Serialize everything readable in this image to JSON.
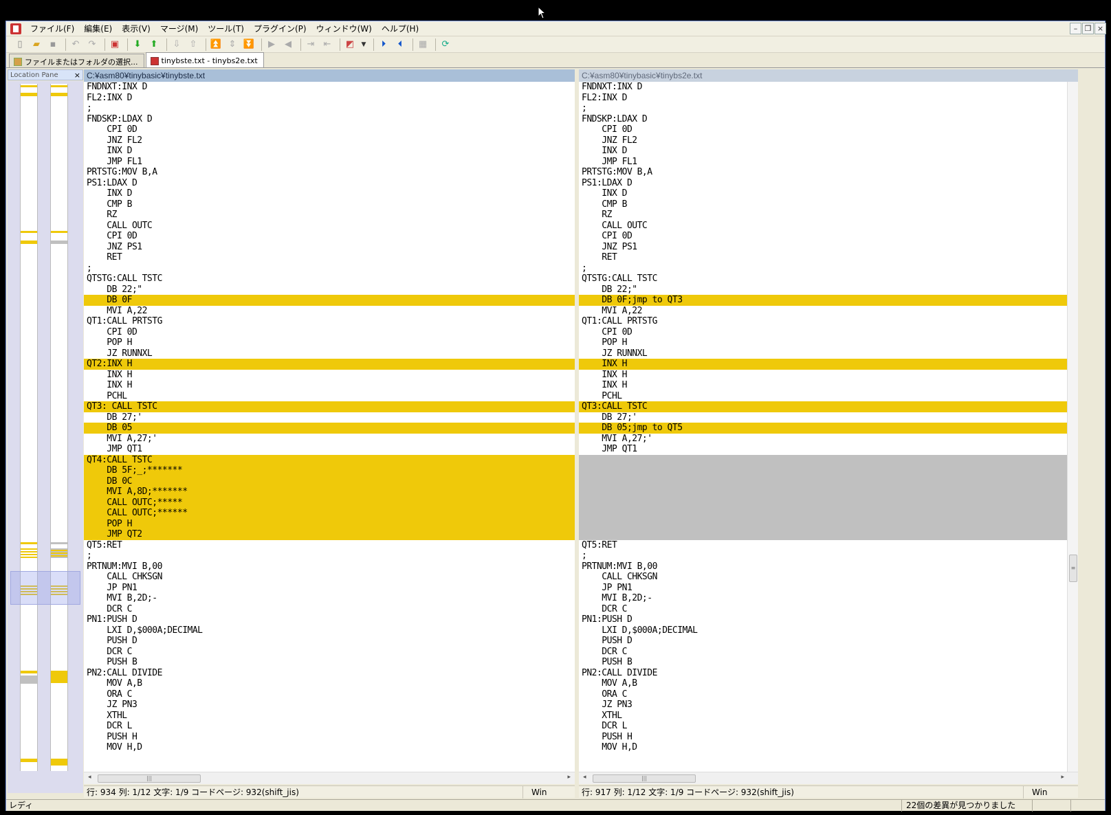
{
  "menu": [
    "ファイル(F)",
    "編集(E)",
    "表示(V)",
    "マージ(M)",
    "ツール(T)",
    "プラグイン(P)",
    "ウィンドウ(W)",
    "ヘルプ(H)"
  ],
  "tabs": [
    {
      "label": "ファイルまたはフォルダの選択..."
    },
    {
      "label": "tinybste.txt - tinybs2e.txt"
    }
  ],
  "location_pane": {
    "title": "Location Pane",
    "close": "×"
  },
  "left": {
    "path": "C:¥asm80¥tinybasic¥tinybste.txt",
    "status": "行: 934  列: 1/12  文字: 1/9  コードページ: 932(shift_jis)",
    "eol": "Win"
  },
  "right": {
    "path": "C:¥asm80¥tinybasic¥tinybs2e.txt",
    "status": "行: 917  列: 1/12  文字: 1/9  コードページ: 932(shift_jis)",
    "eol": "Win"
  },
  "status_bar": {
    "ready": "レディ",
    "diff_count": "22個の差異が見つかりました"
  },
  "colors": {
    "diff": "#efc90a",
    "gap": "#c0c0c0",
    "word_diff": "#f5c8a0"
  },
  "left_lines": [
    {
      "t": "FNDNXT:INX D"
    },
    {
      "t": "FL2:INX D"
    },
    {
      "t": ";"
    },
    {
      "t": "FNDSKP:LDAX D"
    },
    {
      "t": "    CPI 0D"
    },
    {
      "t": "    JNZ FL2"
    },
    {
      "t": "    INX D"
    },
    {
      "t": "    JMP FL1"
    },
    {
      "t": "PRTSTG:MOV B,A"
    },
    {
      "t": "PS1:LDAX D"
    },
    {
      "t": "    INX D"
    },
    {
      "t": "    CMP B"
    },
    {
      "t": "    RZ"
    },
    {
      "t": "    CALL OUTC"
    },
    {
      "t": "    CPI 0D"
    },
    {
      "t": "    JNZ PS1"
    },
    {
      "t": "    RET"
    },
    {
      "t": ";"
    },
    {
      "t": "QTSTG:CALL TSTC"
    },
    {
      "t": "    DB 22;\""
    },
    {
      "t": "    DB 0F",
      "k": "diff"
    },
    {
      "t": "    MVI A,22"
    },
    {
      "t": "QT1:CALL PRTSTG"
    },
    {
      "t": "    CPI 0D"
    },
    {
      "t": "    POP H"
    },
    {
      "t": "    JZ RUNNXL"
    },
    {
      "t": "QT2:INX H",
      "k": "diff"
    },
    {
      "t": "    INX H"
    },
    {
      "t": "    INX H"
    },
    {
      "t": "    PCHL"
    },
    {
      "t": "QT3: CALL TSTC",
      "k": "diff"
    },
    {
      "t": "    DB 27;'"
    },
    {
      "t": "    DB 05",
      "k": "diff"
    },
    {
      "t": "    MVI A,27;'"
    },
    {
      "t": "    JMP QT1"
    },
    {
      "t": "QT4:CALL TSTC",
      "k": "diff"
    },
    {
      "t": "    DB 5F;_;*******",
      "k": "diff"
    },
    {
      "t": "    DB 0C",
      "k": "diff"
    },
    {
      "t": "    MVI A,8D;*******",
      "k": "diff"
    },
    {
      "t": "    CALL OUTC;*****",
      "k": "diff"
    },
    {
      "t": "    CALL OUTC;******",
      "k": "diff"
    },
    {
      "t": "    POP H",
      "k": "diff"
    },
    {
      "t": "    JMP QT2",
      "k": "diff"
    },
    {
      "t": "QT5:RET"
    },
    {
      "t": ";"
    },
    {
      "t": "PRTNUM:MVI B,00"
    },
    {
      "t": "    CALL CHKSGN"
    },
    {
      "t": "    JP PN1"
    },
    {
      "t": "    MVI B,2D;-"
    },
    {
      "t": "    DCR C"
    },
    {
      "t": "PN1:PUSH D"
    },
    {
      "t": "    LXI D,$000A;DECIMAL"
    },
    {
      "t": "    PUSH D"
    },
    {
      "t": "    DCR C"
    },
    {
      "t": "    PUSH B"
    },
    {
      "t": "PN2:CALL DIVIDE"
    },
    {
      "t": "    MOV A,B"
    },
    {
      "t": "    ORA C"
    },
    {
      "t": "    JZ PN3"
    },
    {
      "t": "    XTHL"
    },
    {
      "t": "    DCR L"
    },
    {
      "t": "    PUSH H"
    },
    {
      "t": "    MOV H,D"
    }
  ],
  "right_lines": [
    {
      "t": "FNDNXT:INX D"
    },
    {
      "t": "FL2:INX D"
    },
    {
      "t": ";"
    },
    {
      "t": "FNDSKP:LDAX D"
    },
    {
      "t": "    CPI 0D"
    },
    {
      "t": "    JNZ FL2"
    },
    {
      "t": "    INX D"
    },
    {
      "t": "    JMP FL1"
    },
    {
      "t": "PRTSTG:MOV B,A"
    },
    {
      "t": "PS1:LDAX D"
    },
    {
      "t": "    INX D"
    },
    {
      "t": "    CMP B"
    },
    {
      "t": "    RZ"
    },
    {
      "t": "    CALL OUTC"
    },
    {
      "t": "    CPI 0D"
    },
    {
      "t": "    JNZ PS1"
    },
    {
      "t": "    RET"
    },
    {
      "t": ";"
    },
    {
      "t": "QTSTG:CALL TSTC"
    },
    {
      "t": "    DB 22;\""
    },
    {
      "t": "    DB 0F;jmp to QT3",
      "k": "diff"
    },
    {
      "t": "    MVI A,22"
    },
    {
      "t": "QT1:CALL PRTSTG"
    },
    {
      "t": "    CPI 0D"
    },
    {
      "t": "    POP H"
    },
    {
      "t": "    JZ RUNNXL"
    },
    {
      "t": "    INX H",
      "k": "diff"
    },
    {
      "t": "    INX H"
    },
    {
      "t": "    INX H"
    },
    {
      "t": "    PCHL"
    },
    {
      "t": "QT3:CALL TSTC",
      "k": "diff"
    },
    {
      "t": "    DB 27;'"
    },
    {
      "t": "    DB 05;jmp to QT5",
      "k": "diff"
    },
    {
      "t": "    MVI A,27;'"
    },
    {
      "t": "    JMP QT1"
    },
    {
      "t": "",
      "k": "gap"
    },
    {
      "t": "",
      "k": "gap"
    },
    {
      "t": "",
      "k": "gap"
    },
    {
      "t": "",
      "k": "gap"
    },
    {
      "t": "",
      "k": "gap"
    },
    {
      "t": "",
      "k": "gap"
    },
    {
      "t": "",
      "k": "gap"
    },
    {
      "t": "",
      "k": "gap"
    },
    {
      "t": "QT5:RET"
    },
    {
      "t": ";"
    },
    {
      "t": "PRTNUM:MVI B,00"
    },
    {
      "t": "    CALL CHKSGN"
    },
    {
      "t": "    JP PN1"
    },
    {
      "t": "    MVI B,2D;-"
    },
    {
      "t": "    DCR C"
    },
    {
      "t": "PN1:PUSH D"
    },
    {
      "t": "    LXI D,$000A;DECIMAL"
    },
    {
      "t": "    PUSH D"
    },
    {
      "t": "    DCR C"
    },
    {
      "t": "    PUSH B"
    },
    {
      "t": "PN2:CALL DIVIDE"
    },
    {
      "t": "    MOV A,B"
    },
    {
      "t": "    ORA C"
    },
    {
      "t": "    JZ PN3"
    },
    {
      "t": "    XTHL"
    },
    {
      "t": "    DCR L"
    },
    {
      "t": "    PUSH H"
    },
    {
      "t": "    MOV H,D"
    }
  ]
}
